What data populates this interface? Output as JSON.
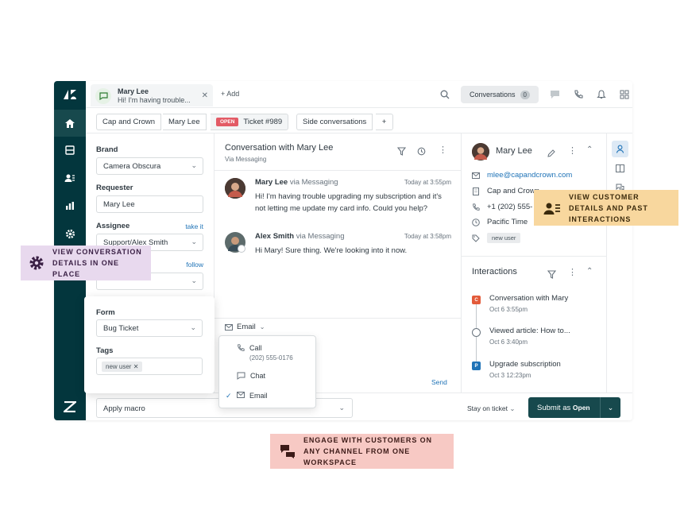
{
  "top": {
    "tab": {
      "name": "Mary Lee",
      "message": "Hi! I'm having trouble..."
    },
    "add_label": "+ Add",
    "conversations_label": "Conversations",
    "conversations_count": "0"
  },
  "crumbs": {
    "org": "Cap and Crown",
    "requester": "Mary Lee",
    "status": "OPEN",
    "ticket": "Ticket #989",
    "side": "Side conversations",
    "plus": "+"
  },
  "fields": {
    "brand_label": "Brand",
    "brand_value": "Camera Obscura",
    "requester_label": "Requester",
    "requester_value": "Mary Lee",
    "assignee_label": "Assignee",
    "assignee_link": "take it",
    "assignee_value": "Support/Alex Smith",
    "follow_link": "follow",
    "form_label": "Form",
    "form_value": "Bug Ticket",
    "tags_label": "Tags",
    "tag_value": "new user"
  },
  "conversation": {
    "title": "Conversation with Mary Lee",
    "subtitle": "Via Messaging",
    "messages": [
      {
        "name": "Mary Lee",
        "via": "via Messaging",
        "time": "Today at 3:55pm",
        "text": "Hi! I'm having trouble upgrading my subscription and it's not letting me update my card info. Could you help?"
      },
      {
        "name": "Alex Smith",
        "via": "via Messaging",
        "time": "Today at 3:58pm",
        "text": "Hi Mary! Sure thing. We're looking into it now."
      }
    ],
    "channel": "Email",
    "send": "Send",
    "dropdown": {
      "call": "Call",
      "call_number": "(202) 555-0176",
      "chat": "Chat",
      "email": "Email"
    }
  },
  "customer": {
    "name": "Mary Lee",
    "email": "mlee@capandcrown.com",
    "company": "Cap and Crown",
    "phone": "+1 (202) 555-",
    "timezone": "Pacific Time",
    "tag": "new user"
  },
  "interactions": {
    "title": "Interactions",
    "items": [
      {
        "title": "Conversation with Mary",
        "date": "Oct 6 3:55pm",
        "color": "#e35b3a",
        "badge": "C"
      },
      {
        "title": "Viewed article: How to...",
        "date": "Oct 6 3:40pm",
        "color": "",
        "badge": ""
      },
      {
        "title": "Upgrade subscription",
        "date": "Oct 3 12:23pm",
        "color": "#1f73b7",
        "badge": "P"
      }
    ]
  },
  "bottom": {
    "macro": "Apply macro",
    "stay": "Stay on ticket",
    "submit_prefix": "Submit as",
    "submit_status": "Open"
  },
  "callouts": {
    "conversation": "VIEW CONVERSATION DETAILS IN ONE PLACE",
    "customer": "VIEW CUSTOMER DETAILS AND PAST INTERACTIONS",
    "channels": "ENGAGE WITH CUSTOMERS ON ANY CHANNEL FROM ONE WORKSPACE"
  },
  "colors": {
    "nav": "#03363d",
    "accent": "#1f73b7",
    "open_badge": "#e35b66",
    "submit": "#17494d"
  }
}
